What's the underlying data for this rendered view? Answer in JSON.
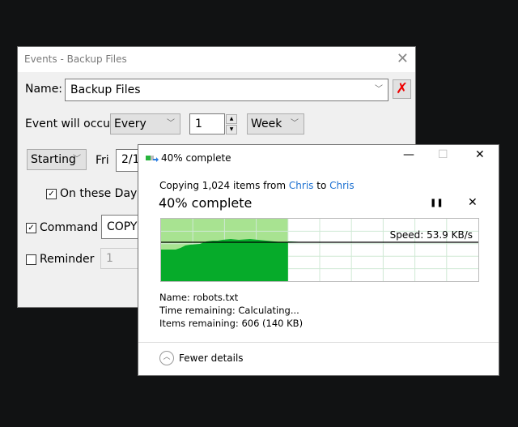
{
  "events_window": {
    "title": "Events - Backup Files",
    "close_label": "✕",
    "name_label": "Name:",
    "name_value": "Backup Files",
    "delete_label": "✗",
    "occur_label": "Event will occur",
    "frequency": "Every",
    "interval": "1",
    "unit": "Week",
    "start_mode": "Starting",
    "start_day": "Fri",
    "start_date": "2/1",
    "on_these_days_label": "On these Days",
    "on_these_days_checked": true,
    "command_label": "Command",
    "command_checked": true,
    "command_value": "COPY",
    "reminder_label": "Reminder",
    "reminder_checked": false,
    "reminder_value": "1"
  },
  "copy_window": {
    "title": "40% complete",
    "minimize_label": "—",
    "maximize_label": "☐",
    "close_label": "✕",
    "copying_prefix": "Copying 1,024 items from ",
    "source": "Chris",
    "to_word": " to ",
    "destination": "Chris",
    "progress_text": "40% complete",
    "progress_percent": 40,
    "pause_label": "❚❚",
    "cancel_label": "✕",
    "speed_label": "Speed: 53.9 KB/s",
    "name_label": "Name:",
    "name_value": "robots.txt",
    "time_label": "Time remaining:",
    "time_value": "Calculating...",
    "items_label": "Items remaining:",
    "items_value": "606 (140 KB)",
    "fewer_details_label": "Fewer details",
    "colors": {
      "progress_bg": "#a8e391",
      "speed_fill": "#06ab2a",
      "grid": "#cfe9d4",
      "link": "#1a6fd1"
    }
  }
}
